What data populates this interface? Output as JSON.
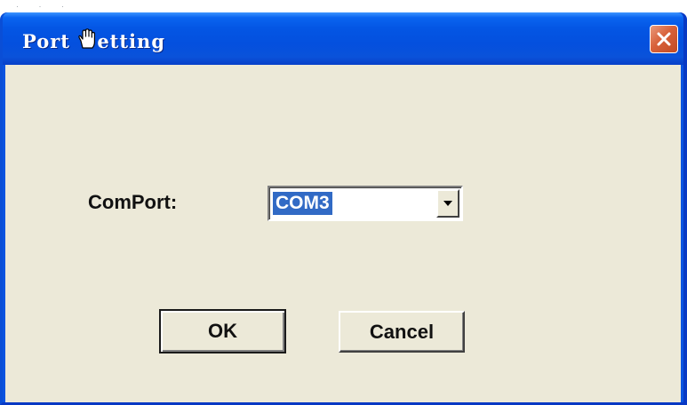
{
  "window": {
    "title_prefix": "Port ",
    "title_suffix": "etting",
    "cursor_icon": "hand-cursor-icon",
    "close_icon": "close-icon"
  },
  "form": {
    "comport_label": "ComPort:",
    "comport_value": "COM3",
    "dropdown_icon": "dropdown-arrow-icon"
  },
  "buttons": {
    "ok_label": "OK",
    "cancel_label": "Cancel"
  },
  "colors": {
    "titlebar": "#0454e0",
    "client_bg": "#ece9d8",
    "selection": "#316ac5",
    "close_button": "#d8613a"
  }
}
